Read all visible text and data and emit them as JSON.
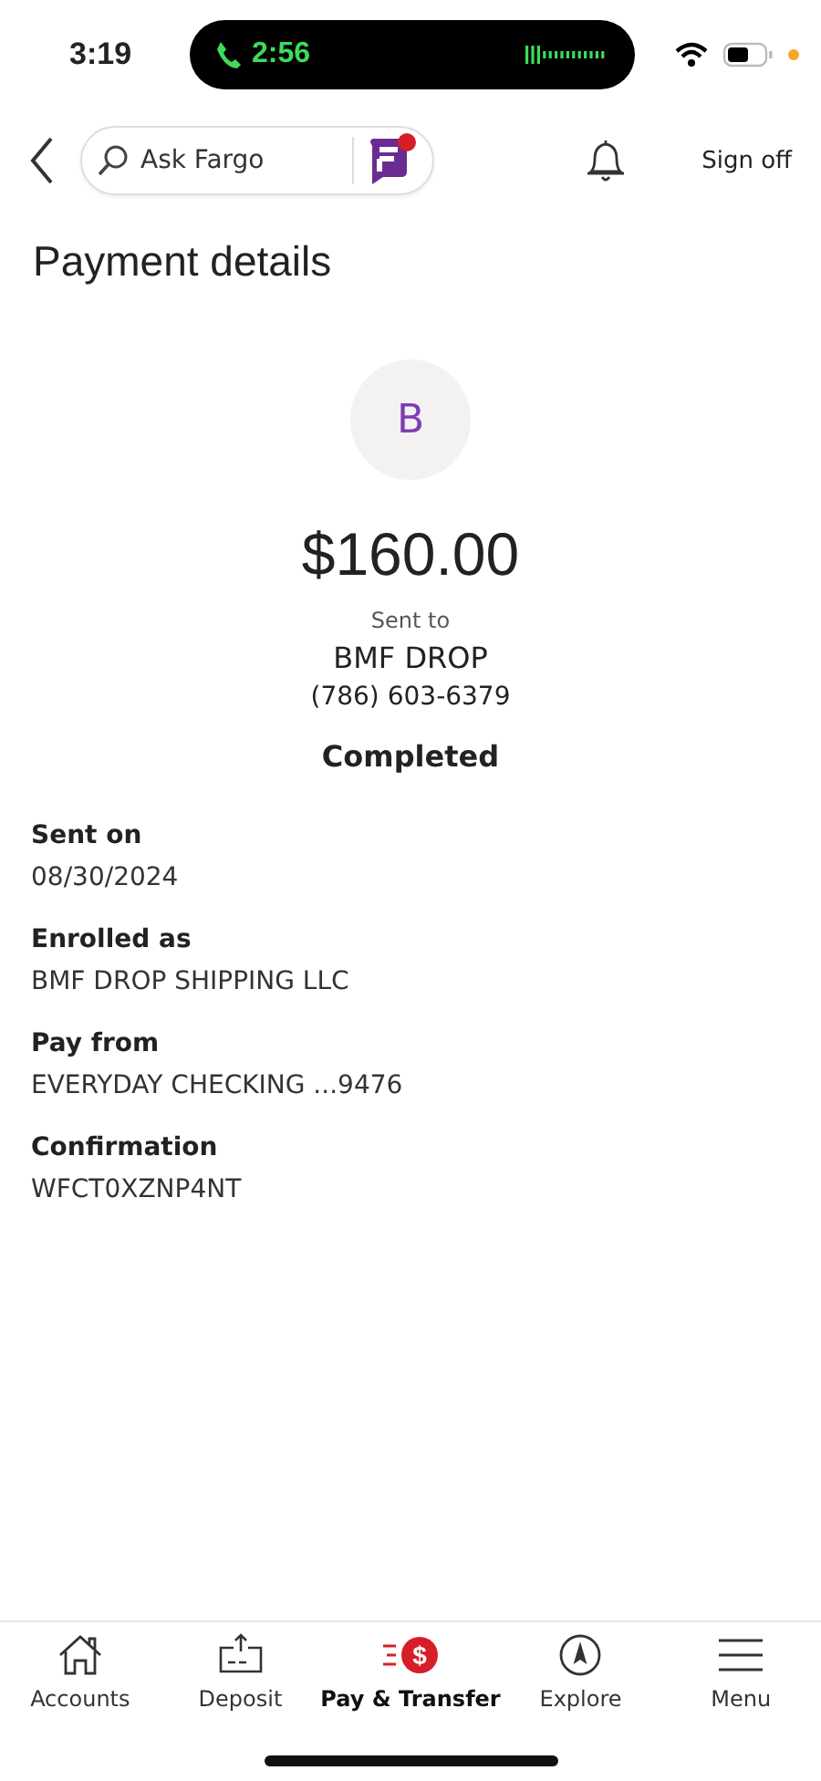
{
  "status_bar": {
    "time": "3:19",
    "call_time": "2:56"
  },
  "header": {
    "search": {
      "placeholder": "Ask Fargo"
    },
    "sign_off": "Sign off"
  },
  "title": "Payment details",
  "payment": {
    "avatar_initial": "B",
    "amount": "$160.00",
    "sent_to_label": "Sent to",
    "recipient": "BMF DROP",
    "phone": "(786) 603-6379",
    "status": "Completed"
  },
  "details": [
    {
      "label": "Sent on",
      "value": "08/30/2024"
    },
    {
      "label": "Enrolled as",
      "value": "BMF DROP SHIPPING LLC"
    },
    {
      "label": "Pay from",
      "value": "EVERYDAY CHECKING ...9476"
    },
    {
      "label": "Confirmation",
      "value": "WFCT0XZNP4NT"
    }
  ],
  "tab_bar": [
    {
      "kind": "home",
      "label": "Accounts",
      "selected": false
    },
    {
      "kind": "deposit",
      "label": "Deposit",
      "selected": false
    },
    {
      "kind": "pay",
      "icon_text": "$",
      "label": "Pay & Transfer",
      "selected": true
    },
    {
      "kind": "explore",
      "label": "Explore",
      "selected": false
    },
    {
      "kind": "menu",
      "label": "Menu",
      "selected": false
    }
  ]
}
